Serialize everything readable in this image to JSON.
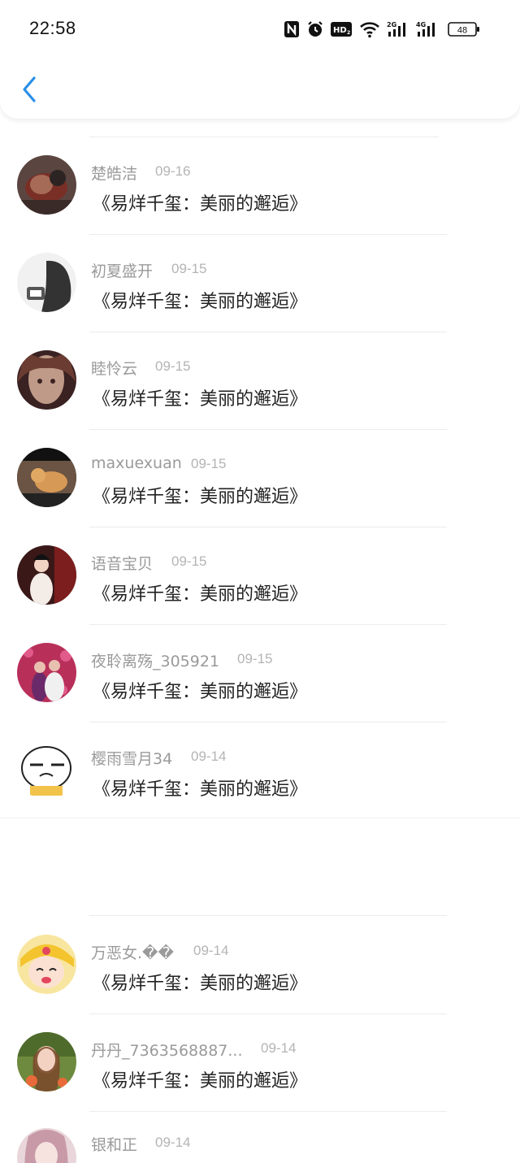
{
  "status_bar": {
    "time": "22:58",
    "icons": [
      "nfc-icon",
      "alarm-icon",
      "hd-icon",
      "wifi-icon",
      "signal-2g-icon",
      "signal-4g-icon",
      "battery-icon"
    ],
    "hd_label": "HD",
    "net1_label": "2G",
    "net2_label": "4G",
    "battery": "48"
  },
  "header": {
    "back_icon": "chevron-left-icon",
    "accent": "#1e90ff"
  },
  "list": [
    {
      "name": "楚皓洁",
      "date": "09-16",
      "message": "《易烊千玺：美丽的邂逅》"
    },
    {
      "name": "初夏盛开",
      "date": "09-15",
      "message": "《易烊千玺：美丽的邂逅》"
    },
    {
      "name": "睦怜云",
      "date": "09-15",
      "message": "《易烊千玺：美丽的邂逅》"
    },
    {
      "name": "maxuexuan",
      "date": "09-15",
      "message": "《易烊千玺：美丽的邂逅》"
    },
    {
      "name": "语音宝贝",
      "date": "09-15",
      "message": "《易烊千玺：美丽的邂逅》"
    },
    {
      "name": "夜聆离殇_305921",
      "date": "09-15",
      "message": "《易烊千玺：美丽的邂逅》"
    },
    {
      "name": "樱雨雪月34",
      "date": "09-14",
      "message": "《易烊千玺：美丽的邂逅》"
    },
    {
      "name": "万恶女.��",
      "date": "09-14",
      "message": "《易烊千玺：美丽的邂逅》"
    },
    {
      "name": "丹丹_7363568887...",
      "date": "09-14",
      "message": "《易烊千玺：美丽的邂逅》"
    },
    {
      "name": "银和正",
      "date": "09-14",
      "message": ""
    }
  ]
}
